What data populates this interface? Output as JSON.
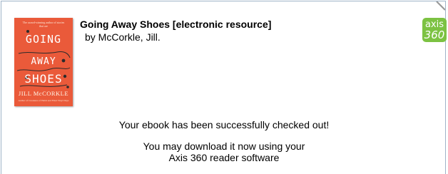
{
  "book": {
    "title": "Going Away Shoes [electronic resource]",
    "byline": "by McCorkle, Jill."
  },
  "cover": {
    "blurb": "The award-winning author of stories that are",
    "title_line1": "GOING",
    "title_line2": "AWAY",
    "title_line3": "SHOES",
    "author": "JILL McCORKLE",
    "footer": "Author of Creatures of Habit and Final Vinyl Days",
    "background_color": "#ea5a3a"
  },
  "logo": {
    "line1": "axis",
    "line2": "360",
    "color": "#7cc242"
  },
  "messages": {
    "success": "Your ebook has been successfully checked out!",
    "download_line1": "You may download it now using your",
    "download_line2": "Axis 360 reader software"
  }
}
